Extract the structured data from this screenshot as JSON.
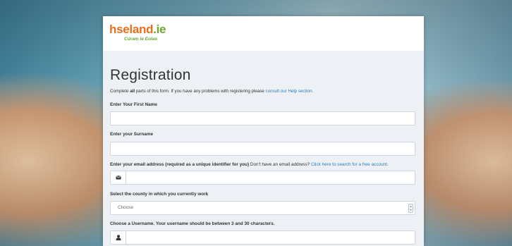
{
  "brand": {
    "logo_hse": "hse",
    "logo_land": "land",
    "logo_dot": ".",
    "logo_ie": "ie",
    "tagline": "Cúram le Eolas"
  },
  "page": {
    "title": "Registration",
    "intro_prefix": "Complete ",
    "intro_bold": "all",
    "intro_mid": " parts of this form. If you have any problems with registering please ",
    "intro_link": "consult our Help section."
  },
  "form": {
    "first_name_label": "Enter Your First Name",
    "first_name_value": "",
    "surname_label": "Enter your Surname",
    "surname_value": "",
    "email_label": "Enter your email address (required as a unique identifier for you)",
    "email_no_address": " Don't have an email address? ",
    "email_link": "Click here to search for a free account.",
    "email_value": "",
    "county_label": "Select the county in which you currently work",
    "county_selected": "Choose",
    "username_label": "Choose a Username. Your username should be between 3 and 30 characters.",
    "username_value": ""
  },
  "icons": {
    "email": "envelope-icon",
    "user": "user-icon",
    "select": "select-arrows-icon"
  },
  "colors": {
    "brand_orange": "#e56f1d",
    "brand_green": "#6aa534",
    "link": "#2e7fbf",
    "panel_bg": "#edf1f5"
  }
}
